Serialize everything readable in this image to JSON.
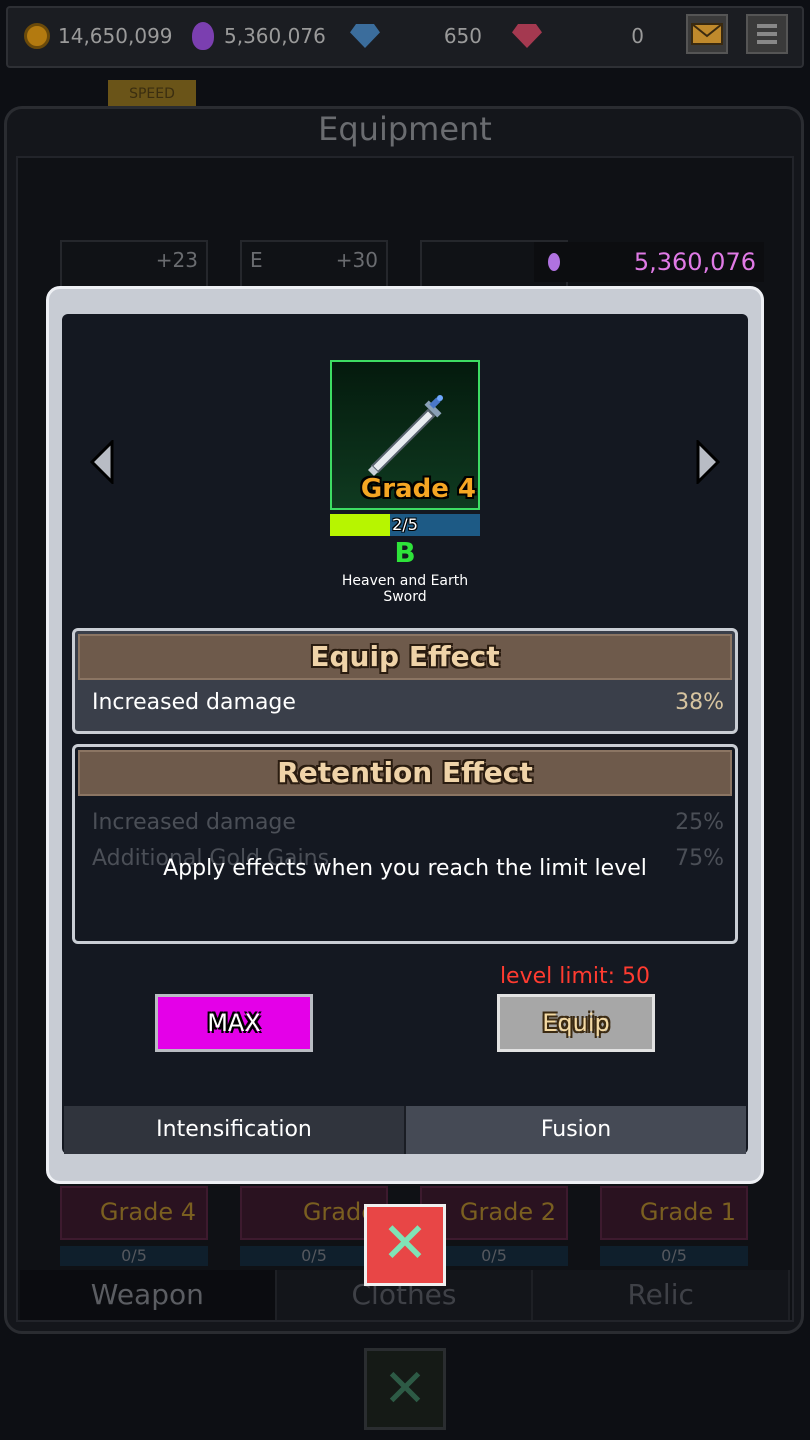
{
  "topbar": {
    "gold": "14,650,099",
    "potion": "5,360,076",
    "diamond": "650",
    "ruby": "0"
  },
  "background": {
    "speed_label": "SPEED",
    "title": "Equipment",
    "slots": [
      "+23",
      "+30"
    ],
    "slot_badge": "E",
    "potion_total": "5,360,076",
    "cards": [
      {
        "grade": "Grade 4",
        "progress": "0/5"
      },
      {
        "grade": "Grade",
        "progress": "0/5"
      },
      {
        "grade": "Grade 2",
        "progress": "0/5"
      },
      {
        "grade": "Grade 1",
        "progress": "0/5"
      }
    ],
    "tabs": [
      "Weapon",
      "Clothes",
      "Relic"
    ]
  },
  "modal": {
    "item": {
      "grade": "Grade 4",
      "progress_text": "2/5",
      "progress_fraction": 0.4,
      "rank": "B",
      "name_line1": "Heaven and Earth",
      "name_line2": "Sword"
    },
    "equip_effect": {
      "title": "Equip Effect",
      "rows": [
        {
          "label": "Increased damage",
          "value": "38%"
        }
      ]
    },
    "retention_effect": {
      "title": "Retention Effect",
      "rows": [
        {
          "label": "Increased damage",
          "value": "25%"
        },
        {
          "label": "Additional Gold Gains",
          "value": "75%"
        }
      ],
      "overlay_text": "Apply effects when you reach the limit level"
    },
    "level_limit": "level limit: 50",
    "max_label": "MAX",
    "equip_label": "Equip",
    "tabs": [
      "Intensification",
      "Fusion"
    ]
  },
  "colors": {
    "grade": "#f5a623",
    "rank": "#2ee33a",
    "limit": "#ff3b30",
    "max_button": "#e400e8",
    "close_button": "#e84646"
  }
}
